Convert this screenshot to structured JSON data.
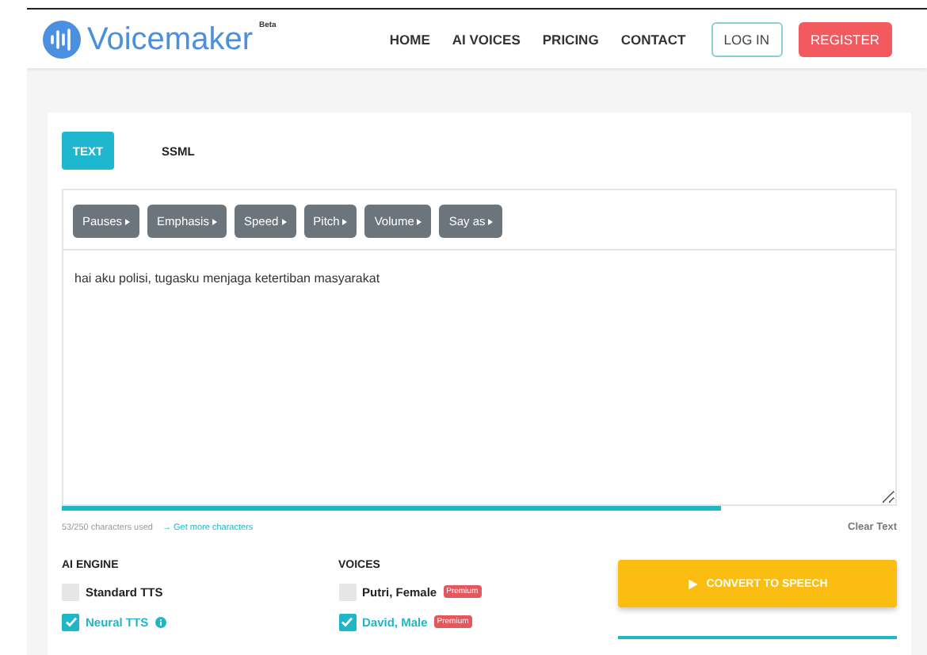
{
  "header": {
    "logo": "Voicemaker",
    "logo_badge": "Beta",
    "nav": [
      {
        "label": "HOME"
      },
      {
        "label": "AI VOICES"
      },
      {
        "label": "PRICING"
      },
      {
        "label": "CONTACT"
      }
    ],
    "login": "LOG IN",
    "register": "REGISTER"
  },
  "tabs": [
    {
      "label": "TEXT",
      "selected": true
    },
    {
      "label": "SSML",
      "selected": false
    }
  ],
  "toolbar": [
    "Pauses",
    "Emphasis",
    "Speed",
    "Pitch",
    "Volume",
    "Say as"
  ],
  "editor": {
    "value": "hai aku polisi, tugasku menjaga ketertiban masyarakat",
    "level": 0.79
  },
  "counter": "53/250 characters used",
  "more_link": "→ Get more characters",
  "clear": "Clear Text",
  "engine": {
    "title": "AI ENGINE",
    "options": [
      {
        "label": "Standard TTS",
        "checked": false
      },
      {
        "label": "Neural TTS",
        "checked": true,
        "info": true
      }
    ]
  },
  "voices": {
    "title": "VOICES",
    "options": [
      {
        "label": "Putri, Female",
        "checked": false,
        "badge": "Premium"
      },
      {
        "label": "David, Male",
        "checked": true,
        "badge": "Premium"
      }
    ]
  },
  "convert": "CONVERT TO SPEECH"
}
